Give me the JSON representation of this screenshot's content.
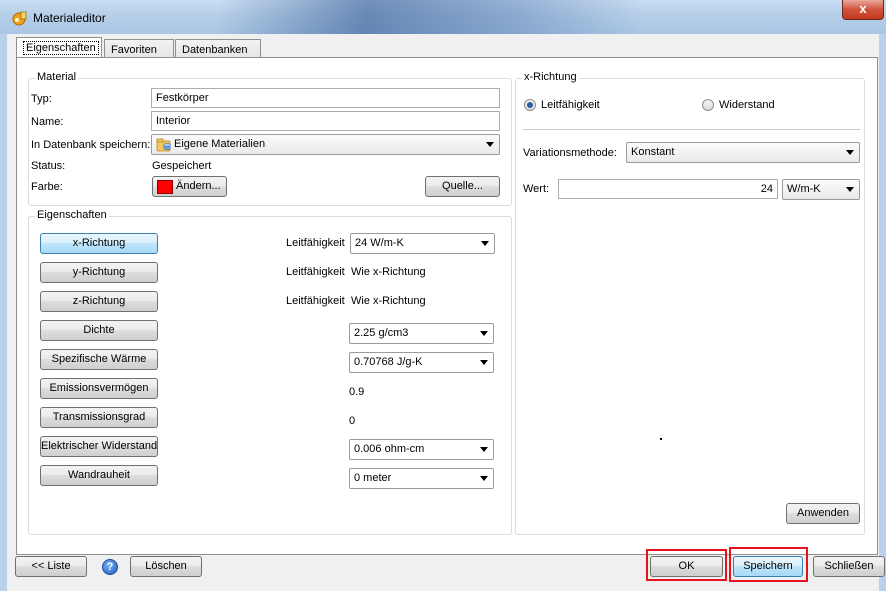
{
  "window": {
    "title": "Materialeditor",
    "close_glyph": "x",
    "icon": "material-editor-icon"
  },
  "tabs": [
    "Eigenschaften",
    "Favoriten",
    "Datenbanken"
  ],
  "material": {
    "group_title": "Material",
    "typ_label": "Typ:",
    "typ_value": "Festkörper",
    "name_label": "Name:",
    "name_value": "Interior",
    "db_label": "In Datenbank speichern:",
    "db_value": "Eigene Materialien",
    "status_label": "Status:",
    "status_value": "Gespeichert",
    "farbe_label": "Farbe:",
    "farbe_button": "Ändern...",
    "farbe_color": "#ff0000",
    "quelle_button": "Quelle..."
  },
  "eigenschaften": {
    "group_title": "Eigenschaften",
    "rows": [
      {
        "button": "x-Richtung",
        "prefix": "Leitfähigkeit",
        "value": "24 W/m-K",
        "kind": "combo",
        "selected": true
      },
      {
        "button": "y-Richtung",
        "prefix": "Leitfähigkeit",
        "value": "Wie x-Richtung",
        "kind": "text"
      },
      {
        "button": "z-Richtung",
        "prefix": "Leitfähigkeit",
        "value": "Wie x-Richtung",
        "kind": "text"
      },
      {
        "button": "Dichte",
        "prefix": "",
        "value": "2.25 g/cm3",
        "kind": "combo"
      },
      {
        "button": "Spezifische Wärme",
        "prefix": "",
        "value": "0.70768 J/g-K",
        "kind": "combo"
      },
      {
        "button": "Emissionsvermögen",
        "prefix": "",
        "value": "0.9",
        "kind": "text"
      },
      {
        "button": "Transmissionsgrad",
        "prefix": "",
        "value": "0",
        "kind": "text"
      },
      {
        "button": "Elektrischer Widerstand",
        "prefix": "",
        "value": "0.006 ohm-cm",
        "kind": "combo"
      },
      {
        "button": "Wandrauheit",
        "prefix": "",
        "value": "0 meter",
        "kind": "combo"
      }
    ]
  },
  "richtung": {
    "group_title": "x-Richtung",
    "radio_1": "Leitfähigkeit",
    "radio_2": "Widerstand",
    "variation_label": "Variationsmethode:",
    "variation_value": "Konstant",
    "wert_label": "Wert:",
    "wert_value": "24",
    "unit_value": "W/m-K",
    "apply_button": "Anwenden"
  },
  "footer": {
    "liste_button": "<< Liste",
    "help_glyph": "?",
    "loeschen_button": "Löschen",
    "ok_button": "OK",
    "speichern_button": "Speichern",
    "schliessen_button": "Schließen"
  },
  "colors": {
    "highlight": "#e4121a",
    "titlebar": "#b6cfe9",
    "selected_button": "#a7d9f5"
  }
}
